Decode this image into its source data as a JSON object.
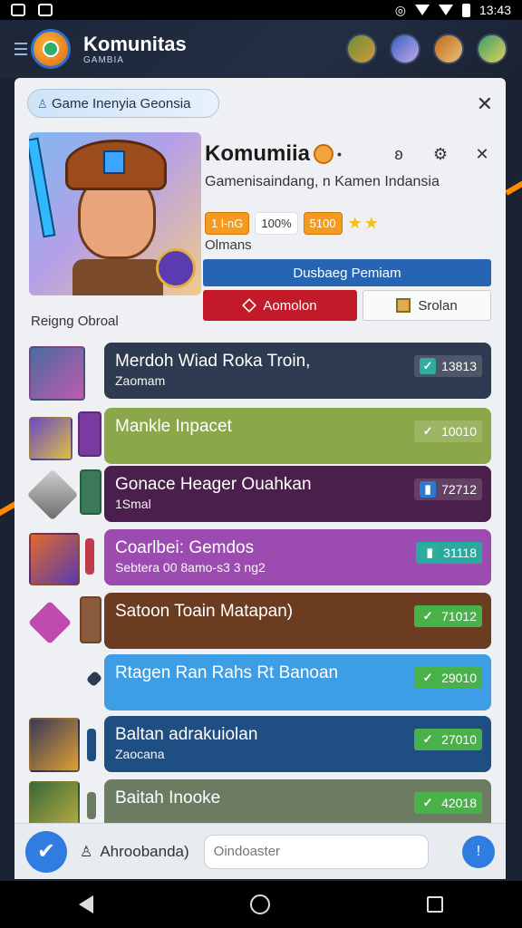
{
  "status_bar": {
    "time": "13:43"
  },
  "header": {
    "title": "Komunitas",
    "subtitle": "GAMBIA"
  },
  "card": {
    "pill_title": "Game Inenyia Geonsia",
    "hero": {
      "name": "Komumiia",
      "name_suffix": "•",
      "subtitle": "Gamenisaindang, n Kamen Indansia",
      "chips": [
        "1 l-nG",
        "100%",
        "5100"
      ],
      "label": "Olmans",
      "primary_button": "Dusbaeg Pemiam",
      "red_button": "Aomolon",
      "light_button": "Srolan"
    },
    "section_label": "Reigng Obroal"
  },
  "list": [
    {
      "title": "Merdoh Wiad Roka Troin,",
      "sub": "Zaomam",
      "score": "13813",
      "color": "#2e3a4f",
      "check": "teal"
    },
    {
      "title": "Mankle Inpacet",
      "sub": "",
      "score": "10010",
      "color": "#8aa84a",
      "check": "plain"
    },
    {
      "title": "Gonace Heager Ouahkan",
      "sub": "1Smal",
      "score": "72712",
      "color": "#4b1f4b",
      "check": "blue"
    },
    {
      "title": "Coarlbei: Gemdos",
      "sub": "Sebtera 00 8amo-s3 3 ng2",
      "score": "31118",
      "color": "#9c4bb0",
      "check": "teal"
    },
    {
      "title": "Satoon Toain Matapan)",
      "sub": "",
      "score": "71012",
      "color": "#6b3c1f",
      "check": "green"
    },
    {
      "title": "Rtagen Ran Rahs Rt Banoan",
      "sub": "",
      "score": "29010",
      "color": "#3d9ee6",
      "check": "green"
    },
    {
      "title": "Baltan adrakuiolan",
      "sub": "Zaocana",
      "score": "27010",
      "color": "#1f4f82",
      "check": "green"
    },
    {
      "title": "Baitah Inooke",
      "sub": "",
      "score": "42018",
      "color": "#6b7c63",
      "check": "green"
    }
  ],
  "bottom_bar": {
    "label": "Ahroobanda)",
    "input_placeholder": "Oindoaster"
  }
}
